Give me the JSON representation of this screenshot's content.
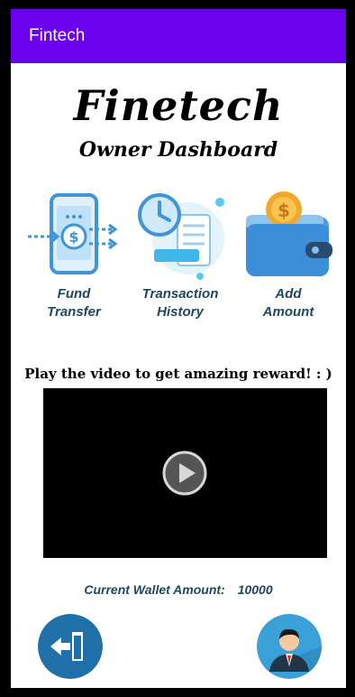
{
  "appbar": {
    "title": "Fintech"
  },
  "brand": {
    "title": "Finetech",
    "subtitle": "Owner Dashboard"
  },
  "actions": [
    {
      "label": "Fund\nTransfer",
      "icon": "fund-transfer-icon"
    },
    {
      "label": "Transaction\nHistory",
      "icon": "transaction-history-icon"
    },
    {
      "label": "Add\nAmount",
      "icon": "wallet-icon"
    }
  ],
  "promo": {
    "text": "Play the video to get amazing reward! : )"
  },
  "video": {
    "icon": "play-icon"
  },
  "wallet": {
    "label": "Current Wallet Amount:",
    "amount": "10000"
  },
  "fabs": {
    "logout_icon": "logout-icon",
    "profile_icon": "profile-avatar-icon"
  },
  "colors": {
    "appbar": "#6a00ee",
    "label": "#20485a",
    "fab": "#1f6fa8",
    "icon_blue": "#5aa9e6",
    "coin": "#f2a92b"
  }
}
